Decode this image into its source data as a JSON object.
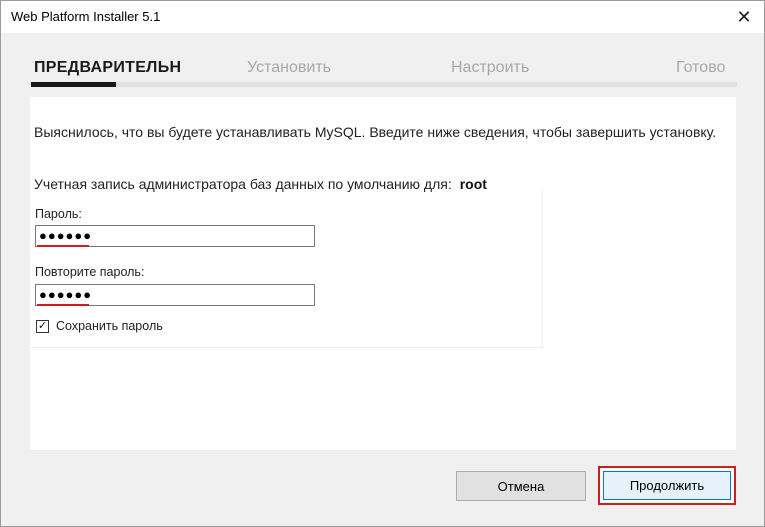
{
  "window": {
    "title": "Web Platform Installer 5.1",
    "close_glyph": "✕"
  },
  "steps": {
    "items": [
      {
        "label": "ПРЕДВАРИТЕЛЬН",
        "active": true
      },
      {
        "label": "Установить",
        "active": false
      },
      {
        "label": "Настроить",
        "active": false
      },
      {
        "label": "Готово",
        "active": false
      }
    ],
    "progress_percent": 12
  },
  "content": {
    "intro_text": "Выяснилось, что вы будете устанавливать MySQL. Введите ниже сведения, чтобы завершить установку.",
    "admin_label": "Учетная запись администратора баз данных по умолчанию для:",
    "admin_user": "root",
    "password_label": "Пароль:",
    "password_value": "●●●●●●",
    "confirm_label": "Повторите пароль:",
    "confirm_value": "●●●●●●",
    "save_password_label": "Сохранить пароль",
    "save_password_checked": true,
    "check_glyph": "✓"
  },
  "buttons": {
    "cancel_label": "Отмена",
    "continue_label": "Продолжить"
  },
  "colors": {
    "highlight": "#cc1f1f",
    "active_step": "#1a1a1a",
    "inactive_step": "#a8a8a8"
  }
}
